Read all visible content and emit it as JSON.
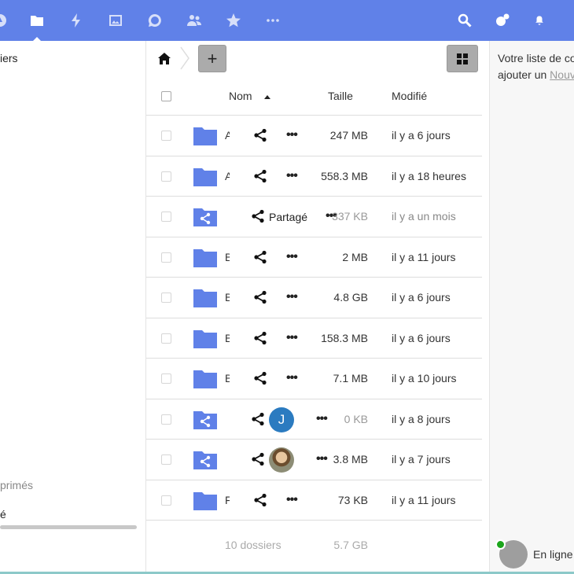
{
  "topbar": {
    "apps": [
      "dashboard-icon",
      "files-icon",
      "activity-icon",
      "photos-icon",
      "talk-icon",
      "contacts-icon",
      "favorites-icon",
      "more-apps-icon"
    ],
    "right_icons": [
      "search-icon",
      "contacts-menu-icon",
      "notifications-icon"
    ],
    "background": "#6081e8"
  },
  "sidebar": {
    "all_files": "iers",
    "deleted_files": "primés",
    "settings": "é"
  },
  "table": {
    "headers": {
      "name": "Nom",
      "size": "Taille",
      "modified": "Modifié"
    },
    "rows": [
      {
        "type": "folder",
        "name": "A",
        "size": "247 MB",
        "modified": "il y a 6 jours",
        "share": "share-icon"
      },
      {
        "type": "folder",
        "name": "A",
        "size": "558.3 MB",
        "modified": "il y a 18 heures",
        "share": "share-icon"
      },
      {
        "type": "shared-folder",
        "name": "",
        "shared_label": "Partagé",
        "size": "337 KB",
        "modified": "il y a un mois",
        "share": "share-icon"
      },
      {
        "type": "folder",
        "name": "B",
        "size": "2 MB",
        "modified": "il y a 11 jours",
        "share": "share-icon"
      },
      {
        "type": "folder",
        "name": "B",
        "size": "4.8 GB",
        "modified": "il y a 6 jours",
        "share": "share-icon"
      },
      {
        "type": "folder",
        "name": "B",
        "size": "158.3 MB",
        "modified": "il y a 6 jours",
        "share": "share-icon"
      },
      {
        "type": "folder",
        "name": "B",
        "size": "7.1 MB",
        "modified": "il y a 10 jours",
        "share": "share-icon"
      },
      {
        "type": "shared-folder",
        "name": "",
        "avatar_initial": "J",
        "size": "0 KB",
        "modified": "il y a 8 jours",
        "share": "share-icon"
      },
      {
        "type": "shared-folder",
        "name": "",
        "avatar": "photo",
        "size": "3.8 MB",
        "modified": "il y a 7 jours",
        "share": "share-icon"
      },
      {
        "type": "folder",
        "name": "F",
        "size": "73 KB",
        "modified": "il y a 11 jours",
        "share": "share-icon"
      }
    ],
    "summary": {
      "count": "10 dossiers",
      "total": "5.7 GB"
    }
  },
  "right_panel": {
    "message_line1": "Votre liste de co",
    "message_line2_prefix": "ajouter un ",
    "message_link": "Nouv",
    "status": "En ligne"
  }
}
